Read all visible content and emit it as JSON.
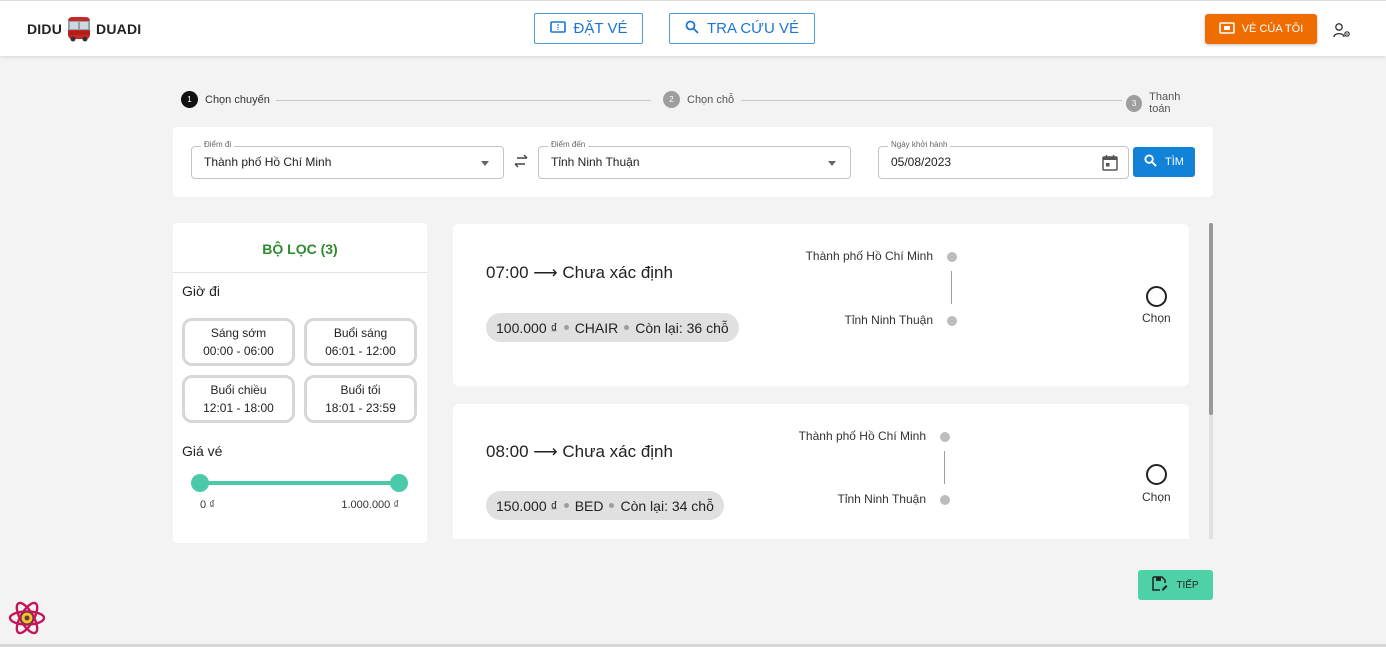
{
  "header": {
    "logo_left": "DIDU",
    "logo_right": "DUADI",
    "nav_book_label": "ĐẶT VÉ",
    "nav_lookup_label": "TRA CỨU VÉ",
    "my_ticket_label": "VÉ CỦA TÔI"
  },
  "stepper": {
    "steps": [
      {
        "num": "1",
        "label": "Chọn chuyến",
        "active": true
      },
      {
        "num": "2",
        "label": "Chọn chỗ",
        "active": false
      },
      {
        "num": "3",
        "label": "Thanh toán",
        "active": false
      }
    ]
  },
  "search": {
    "from_label": "Điểm đi",
    "from_value": "Thành phố Hồ Chí Minh",
    "to_label": "Điểm đến",
    "to_value": "Tỉnh Ninh Thuận",
    "date_label": "Ngày khởi hành",
    "date_value": "05/08/2023",
    "search_button": "TÌM"
  },
  "filter": {
    "title": "BỘ LỌC (3)",
    "departure_section": "Giờ đi",
    "time_slots": [
      {
        "name": "Sáng sớm",
        "range": "00:00 - 06:00"
      },
      {
        "name": "Buổi sáng",
        "range": "06:01 - 12:00"
      },
      {
        "name": "Buổi chiều",
        "range": "12:01 - 18:00"
      },
      {
        "name": "Buổi tối",
        "range": "18:01 - 23:59"
      }
    ],
    "price_section": "Giá vé",
    "price_min": "0 ₫",
    "price_max": "1.000.000 ₫"
  },
  "trips": [
    {
      "title": "07:00 ⟶ Chưa xác định",
      "price": "100.000 ₫",
      "seat_type": "CHAIR",
      "remaining": "Còn lại: 36 chỗ",
      "origin": "Thành phố Hồ Chí Minh",
      "destination": "Tỉnh Ninh Thuận",
      "select_label": "Chọn"
    },
    {
      "title": "08:00 ⟶ Chưa xác định",
      "price": "150.000 ₫",
      "seat_type": "BED",
      "remaining": "Còn lại: 34 chỗ",
      "origin": "Thành phố Hồ Chí Minh",
      "destination": "Tỉnh Ninh Thuận",
      "select_label": "Chọn"
    }
  ],
  "actions": {
    "next_label": "TIẾP"
  },
  "colors": {
    "primary": "#1976d2",
    "accent_orange": "#ef6c00",
    "filter_green": "#2e8b2e",
    "slider": "#4bcaa9",
    "next_button": "#4fd1a7"
  },
  "icons": [
    "bus-icon",
    "ticket-icon",
    "search-icon",
    "user-settings-icon",
    "swap-icon",
    "calendar-icon",
    "save-icon",
    "react-icon"
  ]
}
